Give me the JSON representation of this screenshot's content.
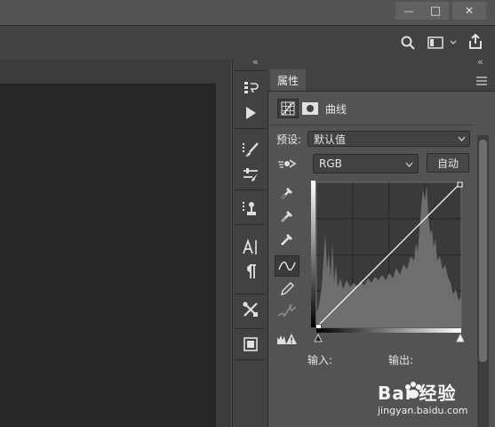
{
  "window": {
    "minimize_glyph": "—",
    "maximize_glyph": "□",
    "close_glyph": "✕"
  },
  "properties_panel": {
    "collapse_glyph": "«",
    "tab_label": "属性",
    "adjustment_name": "曲线",
    "preset_label": "预设:",
    "preset_value": "默认值",
    "channel_value": "RGB",
    "auto_button": "自动",
    "input_label": "输入:",
    "output_label": "输出:"
  },
  "icons": [
    "search-icon",
    "workspace-icon",
    "share-icon",
    "history-icon",
    "play-icon",
    "brush-preset-icon",
    "brush-settings-icon",
    "clone-source-icon",
    "character-icon",
    "paragraph-icon",
    "tools-icon",
    "layer-comps-icon",
    "adjustment-icon",
    "mask-icon",
    "on-image-icon",
    "black-point-eyedropper-icon",
    "gray-point-eyedropper-icon",
    "white-point-eyedropper-icon",
    "curve-point-icon",
    "pencil-icon",
    "smooth-icon",
    "clipping-warning-icon"
  ],
  "curve": {
    "points": [
      [
        0,
        0
      ],
      [
        255,
        255
      ]
    ]
  },
  "watermark": {
    "brand": "Bai 经验",
    "url": "jingyan.baidu.com"
  }
}
